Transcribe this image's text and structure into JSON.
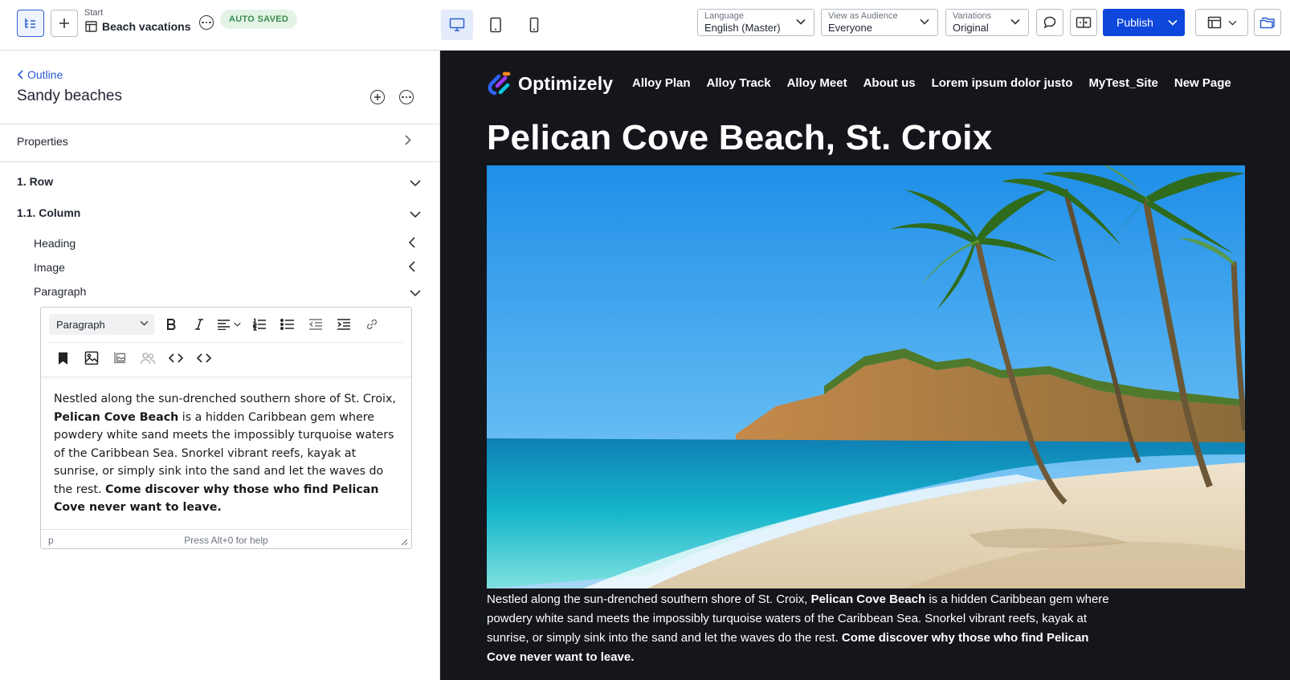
{
  "header": {
    "breadcrumb_parent": "Start",
    "page_title": "Beach vacations",
    "saved_badge": "AUTO SAVED",
    "language": {
      "label": "Language",
      "value": "English (Master)"
    },
    "audience": {
      "label": "View as Audience",
      "value": "Everyone"
    },
    "variations": {
      "label": "Variations",
      "value": "Original"
    },
    "publish_label": "Publish"
  },
  "outline": {
    "back_label": "Outline",
    "title": "Sandy beaches",
    "properties_label": "Properties",
    "row_label": "1. Row",
    "column_label": "1.1. Column",
    "blocks": [
      "Heading",
      "Image",
      "Paragraph"
    ]
  },
  "editor": {
    "format_value": "Paragraph",
    "text_part1": "Nestled along the sun-drenched southern shore of St. Croix, ",
    "text_bold1": "Pelican Cove Beach",
    "text_part2": " is a hidden Caribbean gem where powdery white sand meets the impossibly turquoise waters of the Caribbean Sea. Snorkel vibrant reefs, kayak at sunrise, or simply sink into the sand and let the waves do the rest. ",
    "text_bold2": "Come discover why those who find Pelican Cove never want to leave.",
    "status_tag": "p",
    "status_help": "Press Alt+0 for help"
  },
  "preview": {
    "logo_text": "Optimizely",
    "nav": [
      "Alloy Plan",
      "Alloy Track",
      "Alloy Meet",
      "About us",
      "Lorem ipsum dolor justo",
      "MyTest_Site",
      "New Page"
    ],
    "heading": "Pelican Cove Beach, St. Croix"
  },
  "colors": {
    "accent": "#0d47db",
    "link": "#2b5bd6",
    "preview_bg": "#14161c",
    "saved_bg": "#e3f4e6",
    "saved_text": "#3a8a4f"
  }
}
